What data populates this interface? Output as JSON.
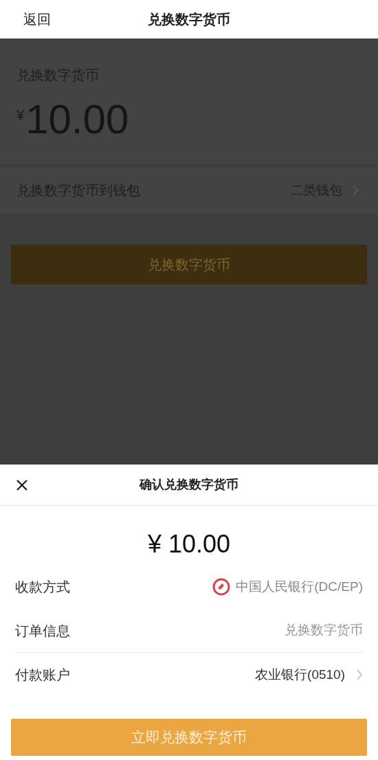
{
  "nav": {
    "back": "返回",
    "title": "兑换数字货币"
  },
  "page": {
    "label": "兑换数字货币",
    "currency": "¥",
    "amount": "10.00",
    "wallet_row": {
      "label": "兑换数字货币到钱包",
      "value": "二类钱包"
    },
    "button": "兑换数字货币"
  },
  "sheet": {
    "title": "确认兑换数字货币",
    "amount": "¥ 10.00",
    "rows": [
      {
        "kind": "bank",
        "label": "收款方式",
        "value": "中国人民银行(DC/EP)"
      },
      {
        "kind": "plain",
        "label": "订单信息",
        "value": "兑换数字货币"
      },
      {
        "kind": "link",
        "label": "付款账户",
        "value": "农业银行(0510)"
      }
    ],
    "button": "立即兑换数字货币"
  }
}
